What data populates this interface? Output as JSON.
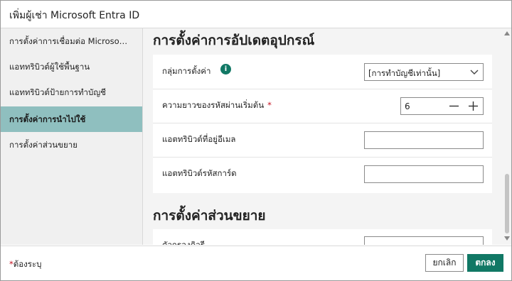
{
  "window": {
    "title": "เพิ่มผู้เช่า Microsoft Entra ID"
  },
  "sidebar": {
    "items": [
      {
        "label": "การตั้งค่าการเชื่อมต่อ Microso…",
        "active": false
      },
      {
        "label": "แอททริบิวต์ผู้ใช้พื้นฐาน",
        "active": false
      },
      {
        "label": "แอททริบิวต์ป้ายการทำบัญชี",
        "active": false
      },
      {
        "label": "การตั้งค่าการนำไปใช้",
        "active": true
      },
      {
        "label": "การตั้งค่าส่วนขยาย",
        "active": false
      }
    ]
  },
  "main": {
    "device_update_heading": "การตั้งค่าการอัปเดตอุปกรณ์",
    "fields": {
      "group_setting": {
        "label": "กลุ่มการตั้งค่า",
        "value": "[การทำบัญชีเท่านั้น]",
        "info_icon": "info-icon"
      },
      "password_length": {
        "label": "ความยาวของรหัสผ่านเริ่มต้น",
        "required_mark": "*",
        "value": "6",
        "decrement_icon": "minus-icon",
        "increment_icon": "plus-icon"
      },
      "email_attribute": {
        "label": "แอตทริบิวต์ที่อยู่อีเมล",
        "value": ""
      },
      "passcode_attribute": {
        "label": "แอตทริบิวต์รหัสการ์ด",
        "value": ""
      }
    },
    "extension_heading": "การตั้งค่าส่วนขยาย",
    "extension_partial_label": "ตัวกรองคิวรี"
  },
  "footer": {
    "required_star": "*",
    "required_note": "ต้องระบุ",
    "cancel_label": "ยกเลิก",
    "ok_label": "ตกลง"
  },
  "colors": {
    "accent": "#117865",
    "active_nav": "#8fbfbf",
    "required": "#c50f1f"
  }
}
